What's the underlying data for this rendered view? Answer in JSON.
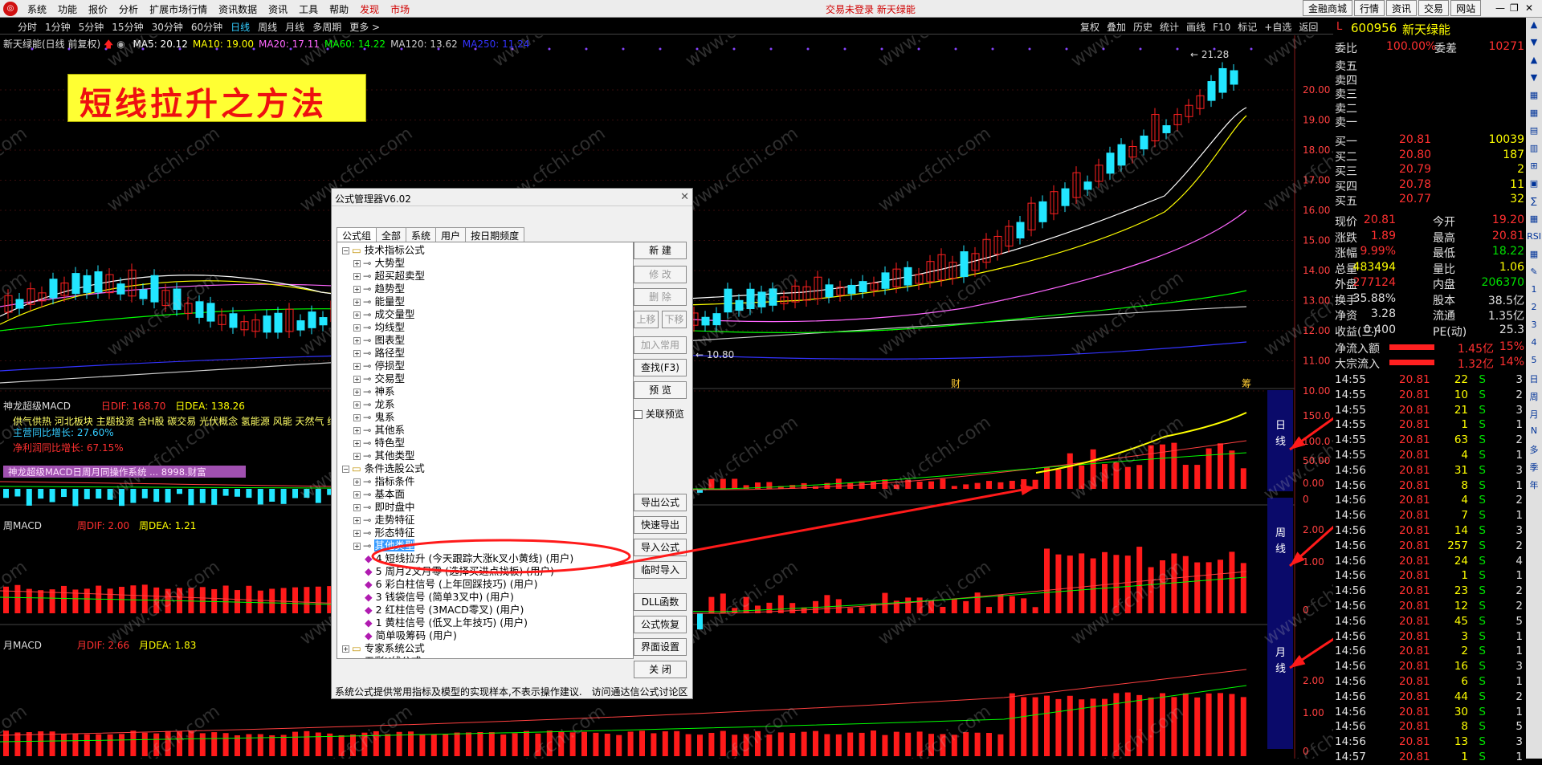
{
  "menubar": {
    "items": [
      "系统",
      "功能",
      "报价",
      "分析",
      "扩展市场行情",
      "资讯数据",
      "资讯",
      "工具",
      "帮助"
    ],
    "red_items": [
      "发现",
      "市场"
    ],
    "center_status": "交易未登录 新天绿能",
    "right_buttons": [
      "金融商城",
      "行情",
      "资讯",
      "交易",
      "网站"
    ],
    "window_buttons": [
      "—",
      "❐",
      "✕"
    ]
  },
  "toolbar": {
    "periods": [
      "分时",
      "1分钟",
      "5分钟",
      "15分钟",
      "30分钟",
      "60分钟",
      "日线",
      "周线",
      "月线",
      "多周期",
      "更多 >"
    ],
    "active_period": "日线",
    "tools": [
      "复权",
      "叠加",
      "历史",
      "统计",
      "画线",
      "F10",
      "标记",
      "+自选",
      "返回"
    ]
  },
  "chart": {
    "title": "新天绿能(日线 前复权)",
    "ma_labels": [
      {
        "text": "MA5: 20.12",
        "color": "#ffffff"
      },
      {
        "text": "MA10: 19.00",
        "color": "#ffff00"
      },
      {
        "text": "MA20: 17.11",
        "color": "#ff66ff"
      },
      {
        "text": "MA60: 14.22",
        "color": "#00ff00"
      },
      {
        "text": "MA120: 13.62",
        "color": "#cccccc"
      },
      {
        "text": "MA250: 11.24",
        "color": "#3333ff"
      }
    ],
    "banner": "短线拉升之方法",
    "high_label": "← 21.28",
    "low_label": "← 10.80",
    "price_ticks": [
      "20.00",
      "19.00",
      "18.00",
      "17.00",
      "16.00",
      "15.00",
      "14.00",
      "13.00",
      "12.00",
      "11.00",
      "10.00"
    ],
    "mark_cai": "财",
    "mark_chou": "筹",
    "watermark": "www.cfchi.com",
    "panels": [
      {
        "name": "神龙超级MACD",
        "dif": "日DIF: 168.70",
        "dea": "日DEA: 138.26",
        "info": "供气供热 河北板块 主题投资 含H股 碳交易 光伏概念 氢能源 风能 天然气 绿",
        "growth1": "主营同比增长: 27.60%",
        "growth2": "净利润同比增长: 67.15%",
        "purple_bar": "神龙超级MACD日周月同操作系统 ... 8998.财富",
        "ticks": [
          "150.0",
          "100.0",
          "50.00",
          "0.00",
          "0"
        ],
        "side_label": "日线"
      },
      {
        "name": "周MACD",
        "dif": "周DIF: 2.00",
        "dea": "周DEA: 1.21",
        "ticks": [
          "2.00",
          "1.00",
          "0"
        ],
        "side_label": "周线"
      },
      {
        "name": "月MACD",
        "dif": "月DIF: 2.66",
        "dea": "月DEA: 1.83",
        "ticks": [
          "2.00",
          "1.00",
          "0"
        ],
        "side_label": "月线"
      }
    ]
  },
  "dialog": {
    "title": "公式管理器V6.02",
    "close": "✕",
    "tabs": [
      "公式组",
      "全部",
      "系统",
      "用户",
      "按日期频度"
    ],
    "tree": [
      {
        "label": "技术指标公式",
        "level": 0,
        "pm": "⊟"
      },
      {
        "label": "大势型",
        "level": 1
      },
      {
        "label": "超买超卖型",
        "level": 1
      },
      {
        "label": "趋势型",
        "level": 1
      },
      {
        "label": "能量型",
        "level": 1
      },
      {
        "label": "成交量型",
        "level": 1
      },
      {
        "label": "均线型",
        "level": 1
      },
      {
        "label": "图表型",
        "level": 1
      },
      {
        "label": "路径型",
        "level": 1
      },
      {
        "label": "停损型",
        "level": 1
      },
      {
        "label": "交易型",
        "level": 1
      },
      {
        "label": "神系",
        "level": 1
      },
      {
        "label": "龙系",
        "level": 1
      },
      {
        "label": "鬼系",
        "level": 1
      },
      {
        "label": "其他系",
        "level": 1
      },
      {
        "label": "特色型",
        "level": 1
      },
      {
        "label": "其他类型",
        "level": 1
      },
      {
        "label": "条件选股公式",
        "level": 0,
        "pm": "⊟"
      },
      {
        "label": "指标条件",
        "level": 1
      },
      {
        "label": "基本面",
        "level": 1
      },
      {
        "label": "即时盘中",
        "level": 1
      },
      {
        "label": "走势特征",
        "level": 1
      },
      {
        "label": "形态特征",
        "level": 1
      },
      {
        "label": "其他类型",
        "level": 1,
        "selected": true
      },
      {
        "label": "4  短线拉升  (今天跟踪大涨k叉小黄线) (用户)",
        "level": 2
      },
      {
        "label": "5  周月2叉月零  (选择买进点找板) (用户)",
        "level": 2
      },
      {
        "label": "6  彩白柱信号  (上年回踩技巧) (用户)",
        "level": 2
      },
      {
        "label": "3  钱袋信号  (简单3叉中) (用户)",
        "level": 2
      },
      {
        "label": "2  红柱信号  (3MACD零叉) (用户)",
        "level": 2
      },
      {
        "label": "1  黄柱信号  (低叉上年技巧) (用户)",
        "level": 2
      },
      {
        "label": "简单吸筹码  (用户)",
        "level": 2
      },
      {
        "label": "专家系统公式",
        "level": 0,
        "pm": "⊞"
      },
      {
        "label": "五彩K线公式",
        "level": 0,
        "pm": "⊞"
      }
    ],
    "buttons": [
      {
        "label": "新  建",
        "enabled": true
      },
      {
        "label": "修  改",
        "enabled": false
      },
      {
        "label": "删  除",
        "enabled": false
      },
      {
        "label": "上移",
        "enabled": false
      },
      {
        "label": "下移",
        "enabled": false
      },
      {
        "label": "加入常用",
        "enabled": false
      },
      {
        "label": "查找(F3)",
        "enabled": true
      },
      {
        "label": "预  览",
        "enabled": true
      },
      {
        "label": "导出公式",
        "enabled": true
      },
      {
        "label": "快速导出",
        "enabled": true
      },
      {
        "label": "导入公式",
        "enabled": true
      },
      {
        "label": "临时导入",
        "enabled": true
      },
      {
        "label": "DLL函数",
        "enabled": true
      },
      {
        "label": "公式恢复",
        "enabled": true
      },
      {
        "label": "界面设置",
        "enabled": true
      },
      {
        "label": "关  闭",
        "enabled": true
      }
    ],
    "checkbox_label": "关联预览",
    "status_left": "系统公式提供常用指标及模型的实现样本,不表示操作建议.",
    "status_right": "访问通达信公式讨论区"
  },
  "quote": {
    "code": "600956",
    "name": "新天绿能",
    "weibi_label": "委比",
    "weibi": "100.00%",
    "weicha_label": "委差",
    "weicha": "10271",
    "sell": [
      "卖五",
      "卖四",
      "卖三",
      "卖二",
      "卖一"
    ],
    "buy": [
      {
        "label": "买一",
        "price": "20.81",
        "vol": "10039"
      },
      {
        "label": "买二",
        "price": "20.80",
        "vol": "187"
      },
      {
        "label": "买三",
        "price": "20.79",
        "vol": "2"
      },
      {
        "label": "买四",
        "price": "20.78",
        "vol": "11"
      },
      {
        "label": "买五",
        "price": "20.77",
        "vol": "32"
      }
    ],
    "stats": [
      [
        "现价",
        "20.81",
        "今开",
        "19.20"
      ],
      [
        "涨跌",
        "1.89",
        "最高",
        "20.81"
      ],
      [
        "涨幅",
        "9.99%",
        "最低",
        "18.22"
      ],
      [
        "总量",
        "483494",
        "量比",
        "1.06"
      ],
      [
        "外盘",
        "277124",
        "内盘",
        "206370"
      ],
      [
        "换手",
        "35.88%",
        "股本",
        "38.5亿"
      ],
      [
        "净资",
        "3.28",
        "流通",
        "1.35亿"
      ],
      [
        "收益(三)",
        "0.400",
        "PE(动)",
        "25.3"
      ]
    ],
    "flows": [
      {
        "label": "净流入额",
        "value": "1.45亿",
        "pct": "15%"
      },
      {
        "label": "大宗流入",
        "value": "1.32亿",
        "pct": "14%"
      }
    ],
    "ticks": [
      [
        "14:55",
        "20.81",
        "22",
        "S",
        "3"
      ],
      [
        "14:55",
        "20.81",
        "10",
        "S",
        "2"
      ],
      [
        "14:55",
        "20.81",
        "21",
        "S",
        "3"
      ],
      [
        "14:55",
        "20.81",
        "1",
        "S",
        "1"
      ],
      [
        "14:55",
        "20.81",
        "63",
        "S",
        "2"
      ],
      [
        "14:55",
        "20.81",
        "4",
        "S",
        "1"
      ],
      [
        "14:56",
        "20.81",
        "31",
        "S",
        "3"
      ],
      [
        "14:56",
        "20.81",
        "8",
        "S",
        "1"
      ],
      [
        "14:56",
        "20.81",
        "4",
        "S",
        "2"
      ],
      [
        "14:56",
        "20.81",
        "7",
        "S",
        "1"
      ],
      [
        "14:56",
        "20.81",
        "14",
        "S",
        "3"
      ],
      [
        "14:56",
        "20.81",
        "257",
        "S",
        "2"
      ],
      [
        "14:56",
        "20.81",
        "24",
        "S",
        "4"
      ],
      [
        "14:56",
        "20.81",
        "1",
        "S",
        "1"
      ],
      [
        "14:56",
        "20.81",
        "23",
        "S",
        "2"
      ],
      [
        "14:56",
        "20.81",
        "12",
        "S",
        "2"
      ],
      [
        "14:56",
        "20.81",
        "45",
        "S",
        "5"
      ],
      [
        "14:56",
        "20.81",
        "3",
        "S",
        "1"
      ],
      [
        "14:56",
        "20.81",
        "2",
        "S",
        "1"
      ],
      [
        "14:56",
        "20.81",
        "16",
        "S",
        "3"
      ],
      [
        "14:56",
        "20.81",
        "6",
        "S",
        "1"
      ],
      [
        "14:56",
        "20.81",
        "44",
        "S",
        "2"
      ],
      [
        "14:56",
        "20.81",
        "30",
        "S",
        "1"
      ],
      [
        "14:56",
        "20.81",
        "8",
        "S",
        "5"
      ],
      [
        "14:56",
        "20.81",
        "13",
        "S",
        "3"
      ],
      [
        "14:57",
        "20.81",
        "1",
        "S",
        "1"
      ]
    ]
  },
  "side_icons": [
    "▲",
    "▼",
    "▲",
    "▼",
    "▦",
    "▦",
    "▤",
    "▥",
    "⊞",
    "▣",
    "∑",
    "▦",
    "RSI",
    "▦",
    "✎",
    "1",
    "2",
    "3",
    "4",
    "5",
    "日",
    "周",
    "月",
    "N",
    "多",
    "季",
    "年"
  ]
}
